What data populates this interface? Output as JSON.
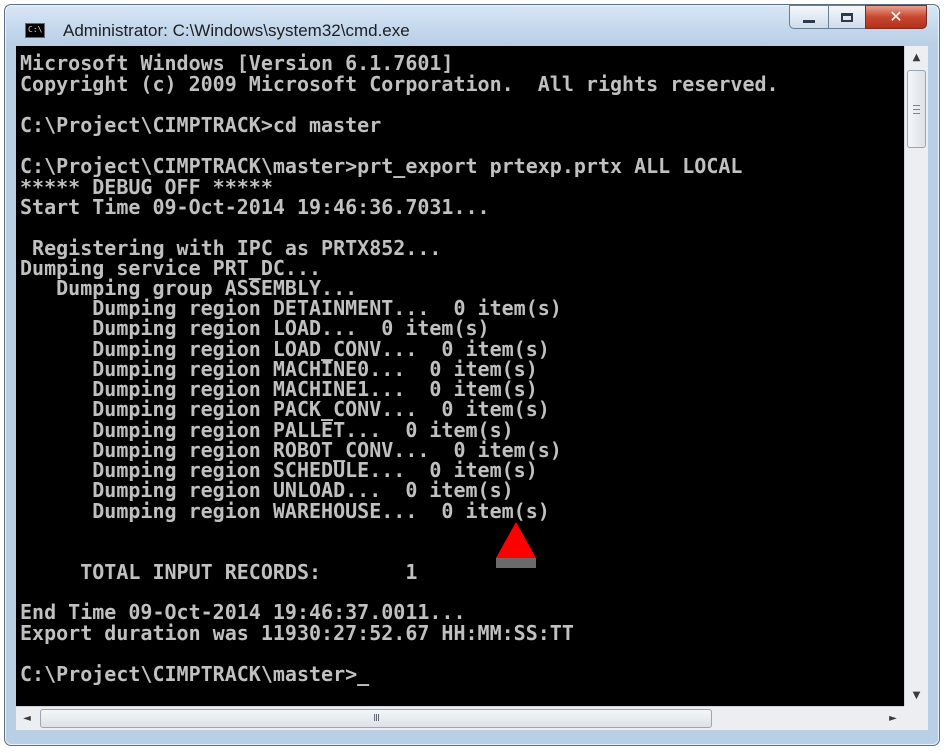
{
  "window": {
    "title": "Administrator: C:\\Windows\\system32\\cmd.exe",
    "app_icon_text": "C:\\",
    "controls": {
      "minimize": "minimize",
      "maximize": "maximize",
      "close": "close"
    }
  },
  "console": {
    "lines": [
      "Microsoft Windows [Version 6.1.7601]",
      "Copyright (c) 2009 Microsoft Corporation.  All rights reserved.",
      "C:\\Project\\CIMPTRACK>cd master",
      "C:\\Project\\CIMPTRACK\\master>prt_export prtexp.prtx ALL LOCAL",
      "***** DEBUG OFF *****",
      "Start Time 09-Oct-2014 19:46:36.7031...",
      " Registering with IPC as PRTX852...",
      "Dumping service PRT_DC...",
      "   Dumping group ASSEMBLY...",
      "      Dumping region DETAINMENT...  0 item(s)",
      "      Dumping region LOAD...  0 item(s)",
      "      Dumping region LOAD_CONV...  0 item(s)",
      "      Dumping region MACHINE0...  0 item(s)",
      "      Dumping region MACHINE1...  0 item(s)",
      "      Dumping region PACK_CONV...  0 item(s)",
      "      Dumping region PALLET...  0 item(s)",
      "      Dumping region ROBOT_CONV...  0 item(s)",
      "      Dumping region SCHEDULE...  0 item(s)",
      "      Dumping region UNLOAD...  0 item(s)",
      "      Dumping region WAREHOUSE...  0 item(s)",
      "     TOTAL INPUT RECORDS:       1",
      "End Time 09-Oct-2014 19:46:37.0011...",
      "Export duration was 11930:27:52.67 HH:MM:SS:TT",
      "C:\\Project\\CIMPTRACK\\master>"
    ],
    "cursor": "_"
  },
  "scrollbars": {
    "horizontal_grip": "III",
    "up_arrow": "▲",
    "down_arrow": "▼",
    "left_arrow": "◄",
    "right_arrow": "►"
  },
  "colors": {
    "console_background": "#000000",
    "console_text": "#c0c0c0",
    "marker": "#ff0000",
    "close_button": "#c7472f"
  },
  "annotation": {
    "marker_icon": "red-triangle-arrow-icon"
  }
}
